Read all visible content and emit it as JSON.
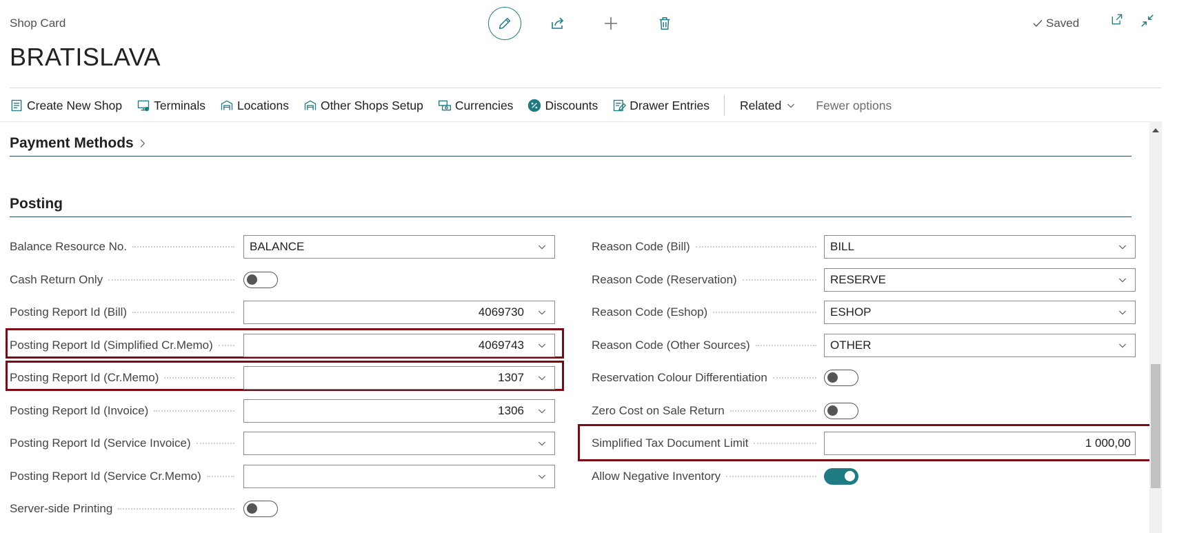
{
  "header": {
    "breadcrumb": "Shop Card",
    "title": "BRATISLAVA",
    "status": "Saved"
  },
  "toolbar": {
    "icons": [
      "edit-icon",
      "share-icon",
      "plus-icon",
      "delete-icon",
      "open-new-window-icon",
      "collapse-icon"
    ]
  },
  "actions": [
    {
      "label": "Create New Shop",
      "icon": "new-document-icon"
    },
    {
      "label": "Terminals",
      "icon": "terminal-icon"
    },
    {
      "label": "Locations",
      "icon": "warehouse-icon"
    },
    {
      "label": "Other Shops Setup",
      "icon": "warehouse-icon"
    },
    {
      "label": "Currencies",
      "icon": "currency-icon"
    },
    {
      "label": "Discounts",
      "icon": "percent-icon"
    },
    {
      "label": "Drawer Entries",
      "icon": "edit-list-icon"
    }
  ],
  "menu": {
    "related": "Related",
    "fewer": "Fewer options"
  },
  "sections": {
    "payment_methods": "Payment Methods",
    "posting": "Posting"
  },
  "left_fields": [
    {
      "label": "Balance Resource No.",
      "type": "select",
      "value": "BALANCE",
      "align": "left"
    },
    {
      "label": "Cash Return Only",
      "type": "toggle",
      "on": false
    },
    {
      "label": "Posting Report Id (Bill)",
      "type": "select",
      "value": "4069730",
      "align": "right"
    },
    {
      "label": "Posting Report Id (Simplified Cr.Memo)",
      "type": "select",
      "value": "4069743",
      "align": "right",
      "highlight": true
    },
    {
      "label": "Posting Report Id (Cr.Memo)",
      "type": "select",
      "value": "1307",
      "align": "right",
      "highlight": true
    },
    {
      "label": "Posting Report Id (Invoice)",
      "type": "select",
      "value": "1306",
      "align": "right"
    },
    {
      "label": "Posting Report Id (Service Invoice)",
      "type": "select",
      "value": "",
      "align": "right"
    },
    {
      "label": "Posting Report Id (Service Cr.Memo)",
      "type": "select",
      "value": "",
      "align": "right"
    },
    {
      "label": "Server-side Printing",
      "type": "toggle",
      "on": false
    }
  ],
  "right_fields": [
    {
      "label": "Reason Code (Bill)",
      "type": "select",
      "value": "BILL",
      "align": "left"
    },
    {
      "label": "Reason Code (Reservation)",
      "type": "select",
      "value": "RESERVE",
      "align": "left"
    },
    {
      "label": "Reason Code (Eshop)",
      "type": "select",
      "value": "ESHOP",
      "align": "left"
    },
    {
      "label": "Reason Code (Other Sources)",
      "type": "select",
      "value": "OTHER",
      "align": "left"
    },
    {
      "label": "Reservation Colour Differentiation",
      "type": "toggle",
      "on": false
    },
    {
      "label": "Zero Cost on Sale Return",
      "type": "toggle",
      "on": false
    },
    {
      "label": "Simplified Tax Document Limit",
      "type": "text",
      "value": "1 000,00",
      "align": "right",
      "highlight": true
    },
    {
      "label": "Allow Negative Inventory",
      "type": "toggle",
      "on": true
    }
  ],
  "colors": {
    "accent": "#1f7b84",
    "highlight": "#7b0a16"
  }
}
